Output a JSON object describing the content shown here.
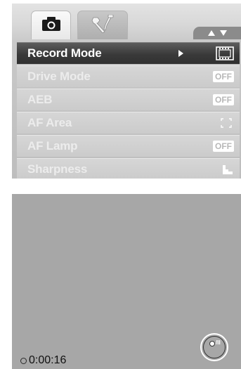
{
  "menu": {
    "tabs": [
      {
        "icon": "camera-icon",
        "active": true
      },
      {
        "icon": "wrench-screwdriver-icon",
        "active": false
      }
    ],
    "nav_icons": [
      "arrow-up-icon",
      "arrow-down-icon"
    ],
    "items": [
      {
        "label": "Record Mode",
        "selected": true,
        "value_icon": "film-frame-icon"
      },
      {
        "label": "Drive Mode",
        "selected": false,
        "value": "OFF"
      },
      {
        "label": "AEB",
        "selected": false,
        "value": "OFF"
      },
      {
        "label": "AF Area",
        "selected": false,
        "value_icon": "af-area-bracket-icon"
      },
      {
        "label": "AF Lamp",
        "selected": false,
        "value": "OFF"
      },
      {
        "label": "Sharpness",
        "selected": false,
        "value_icon": "sharpness-icon"
      }
    ]
  },
  "liveview": {
    "timer": "0:00:16",
    "mode_icon": "photo-video-mode-icon"
  },
  "colors": {
    "selected_row": "#3a3a3a",
    "row": "#cbcbcb",
    "liveview_bg": "#a7a7a7"
  }
}
